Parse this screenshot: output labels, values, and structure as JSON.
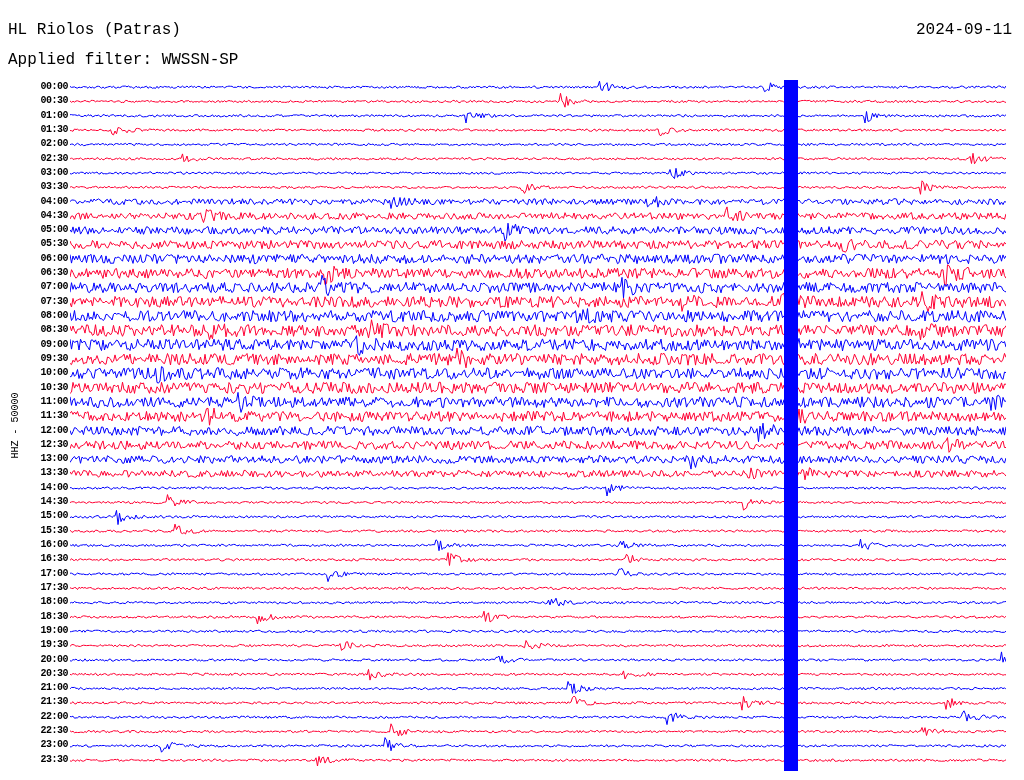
{
  "header": {
    "station": "HL Riolos (Patras)",
    "date": "2024-09-11",
    "filter": "Applied filter: WWSSN-SP"
  },
  "plot": {
    "axis_label": "HHZ - 50000",
    "rows": [
      {
        "time": "00:00",
        "color": "#0000ff"
      },
      {
        "time": "00:30",
        "color": "#ff0033"
      },
      {
        "time": "01:00",
        "color": "#0000ff"
      },
      {
        "time": "01:30",
        "color": "#ff0033"
      },
      {
        "time": "02:00",
        "color": "#0000ff"
      },
      {
        "time": "02:30",
        "color": "#ff0033"
      },
      {
        "time": "03:00",
        "color": "#0000ff"
      },
      {
        "time": "03:30",
        "color": "#ff0033"
      },
      {
        "time": "04:00",
        "color": "#0000ff"
      },
      {
        "time": "04:30",
        "color": "#ff0033"
      },
      {
        "time": "05:00",
        "color": "#0000ff"
      },
      {
        "time": "05:30",
        "color": "#ff0033"
      },
      {
        "time": "06:00",
        "color": "#0000ff"
      },
      {
        "time": "06:30",
        "color": "#ff0033"
      },
      {
        "time": "07:00",
        "color": "#0000ff"
      },
      {
        "time": "07:30",
        "color": "#ff0033"
      },
      {
        "time": "08:00",
        "color": "#0000ff"
      },
      {
        "time": "08:30",
        "color": "#ff0033"
      },
      {
        "time": "09:00",
        "color": "#0000ff"
      },
      {
        "time": "09:30",
        "color": "#ff0033"
      },
      {
        "time": "10:00",
        "color": "#0000ff"
      },
      {
        "time": "10:30",
        "color": "#ff0033"
      },
      {
        "time": "11:00",
        "color": "#0000ff"
      },
      {
        "time": "11:30",
        "color": "#ff0033"
      },
      {
        "time": "12:00",
        "color": "#0000ff"
      },
      {
        "time": "12:30",
        "color": "#ff0033"
      },
      {
        "time": "13:00",
        "color": "#0000ff"
      },
      {
        "time": "13:30",
        "color": "#ff0033"
      },
      {
        "time": "14:00",
        "color": "#0000ff"
      },
      {
        "time": "14:30",
        "color": "#ff0033"
      },
      {
        "time": "15:00",
        "color": "#0000ff"
      },
      {
        "time": "15:30",
        "color": "#ff0033"
      },
      {
        "time": "16:00",
        "color": "#0000ff"
      },
      {
        "time": "16:30",
        "color": "#ff0033"
      },
      {
        "time": "17:00",
        "color": "#0000ff"
      },
      {
        "time": "17:30",
        "color": "#ff0033"
      },
      {
        "time": "18:00",
        "color": "#0000ff"
      },
      {
        "time": "18:30",
        "color": "#ff0033"
      },
      {
        "time": "19:00",
        "color": "#0000ff"
      },
      {
        "time": "19:30",
        "color": "#ff0033"
      },
      {
        "time": "20:00",
        "color": "#0000ff"
      },
      {
        "time": "20:30",
        "color": "#ff0033"
      },
      {
        "time": "21:00",
        "color": "#0000ff"
      },
      {
        "time": "21:30",
        "color": "#ff0033"
      },
      {
        "time": "22:00",
        "color": "#0000ff"
      },
      {
        "time": "22:30",
        "color": "#ff0033"
      },
      {
        "time": "23:00",
        "color": "#0000ff"
      },
      {
        "time": "23:30",
        "color": "#ff0033"
      }
    ]
  }
}
